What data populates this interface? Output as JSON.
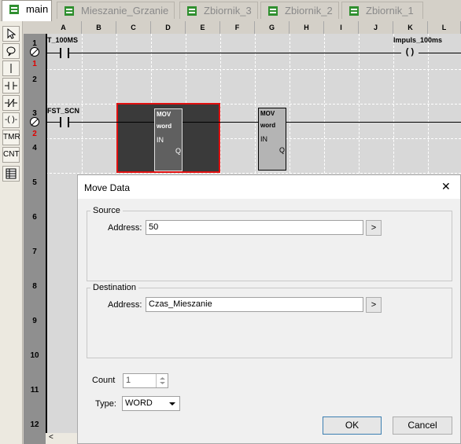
{
  "tabs": [
    {
      "label": "main"
    },
    {
      "label": "Mieszanie_Grzanie"
    },
    {
      "label": "Zbiornik_3"
    },
    {
      "label": "Zbiornik_2"
    },
    {
      "label": "Zbiornik_1"
    }
  ],
  "toolbar": [
    "cursor",
    "coil-tool",
    "vertical-line",
    "contact-no",
    "contact-nc",
    "coil",
    "TMR",
    "CNT",
    "table"
  ],
  "toolbar_labels": {
    "tmr": "TMR",
    "cnt": "CNT",
    "coil": "-( )-"
  },
  "columns": [
    "A",
    "B",
    "C",
    "D",
    "E",
    "F",
    "G",
    "H",
    "I",
    "J",
    "K",
    "L"
  ],
  "rows": [
    "1",
    "2",
    "3",
    "4",
    "5",
    "6",
    "7",
    "8",
    "9",
    "10",
    "11",
    "12"
  ],
  "rung_markers": [
    "1",
    "2"
  ],
  "ladder": {
    "contact1": "T_100MS",
    "coil1": "Impuls_100ms",
    "coil1_symbol": "( )",
    "contact2": "FST_SCN",
    "mov1": {
      "name": "MOV",
      "type": "word",
      "in": "IN",
      "out": "Q"
    },
    "mov2": {
      "name": "MOV",
      "type": "word",
      "in": "IN",
      "out": "Q"
    }
  },
  "dialog": {
    "title": "Move Data",
    "close": "✕",
    "source": {
      "title": "Source",
      "address_label": "Address:",
      "address_value": "50",
      "browse": ">"
    },
    "destination": {
      "title": "Destination",
      "address_label": "Address:",
      "address_value": "Czas_Mieszanie",
      "browse": ">"
    },
    "count_label": "Count",
    "count_value": "1",
    "type_label": "Type:",
    "type_value": "WORD",
    "ok": "OK",
    "cancel": "Cancel"
  },
  "scroll_left": "<"
}
